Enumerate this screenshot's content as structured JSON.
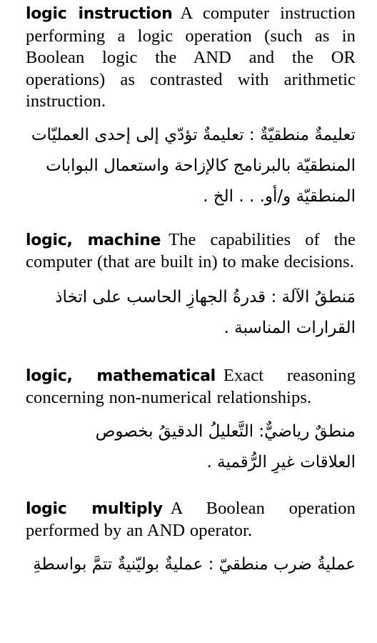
{
  "page": {
    "language_primary": "English",
    "language_secondary": "Arabic",
    "direction_secondary": "rtl"
  },
  "entries": [
    {
      "id": "logic-instruction",
      "headword": "logic instruction",
      "definition": "A computer instruction performing a logic operation (such as in Boolean logic the AND and the OR operations) as contrasted with arithmetic instruction.",
      "arabic_lines": [
        "تعليمةٌ منطقيّةٌ : تعليمةٌ تؤدّي إلى إحدى العمليّات",
        "المنطقيّة بالبرنامج كالإزاحة واستعمال البوابات",
        "المنطقيّة و/أو. . . الخ ."
      ]
    },
    {
      "id": "logic-machine",
      "headword": "logic, machine",
      "definition": "The capabilities of the computer (that are built in) to make decisions.",
      "arabic_lines": [
        "مَنطقُ الآلة : قدرةُ الجهازِ الحاسب على اتخاذ",
        "القرارات المناسبة ."
      ]
    },
    {
      "id": "logic-mathematical",
      "headword": "logic, mathematical",
      "definition": "Exact reasoning concerning non-numerical relationships.",
      "arabic_lines": [
        "منطقٌ رياضيٌّ: التَّعليلُ الدقيقُ بخصوص",
        "العلاقات غيرِ الرُّقمية ."
      ]
    },
    {
      "id": "logic-multiply",
      "headword": "logic multiply",
      "definition": "A Boolean operation performed by an AND operator.",
      "arabic_lines": [
        "عمليةُ ضرب منطقيّ : عمليةٌ بوليّنيةٌ تتمَّ بواسطةِ"
      ]
    }
  ]
}
